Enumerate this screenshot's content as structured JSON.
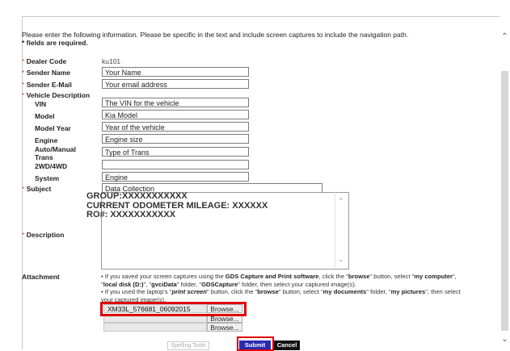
{
  "intro": "Please enter the following information. Please be specific in the text and include screen captures to include the navigation path.",
  "required_note": "* fields are required.",
  "fields": {
    "dealer_code": {
      "label": "Dealer Code",
      "value": "ku101"
    },
    "sender_name": {
      "label": "Sender Name",
      "value": "Your Name"
    },
    "sender_email": {
      "label": "Sender E-Mail",
      "value": "Your email address"
    },
    "vehicle_description": {
      "label": "Vehicle Description"
    },
    "vin": {
      "label": "VIN",
      "value": "The VIN for the vehicle"
    },
    "model": {
      "label": "Model",
      "value": "Kia Model"
    },
    "model_year": {
      "label": "Model Year",
      "value": "Year of the vehicle"
    },
    "engine": {
      "label": "Engine",
      "value": "Engine size"
    },
    "trans": {
      "label": "Auto/Manual Trans",
      "value": "Type of Trans"
    },
    "drive": {
      "label": "2WD/4WD",
      "value": ""
    },
    "system": {
      "label": "System",
      "value": "Engine"
    },
    "subject": {
      "label": "Subject",
      "value": "Data Collection"
    },
    "description": {
      "label": "Description",
      "value": "GROUP:XXXXXXXXXXX\nCURRENT ODOMETER MILEAGE: XXXXXX\nRO#: XXXXXXXXXXX"
    }
  },
  "attachment": {
    "label": "Attachment",
    "line1_pre": "If you saved your screen captures using the ",
    "line1_bold": "GDS Capture and Print software",
    "line1_mid": ", click the \"",
    "line1_browse": "browse",
    "line1_mid2": "\" button, select \"",
    "line1_mycomp": "my computer",
    "line1_end": "\",",
    "line2_pre": "\"",
    "line2_disk": "local disk (D:)",
    "line2_mid": "\", \"",
    "line2_gvci": "gvciData",
    "line2_mid2": "\" folder, \"",
    "line2_gds": "GDSCapture",
    "line2_end": "\" folder, then select your captured image(s).",
    "line3_pre": "If you used the laptop's \"",
    "line3_ps": "print screen",
    "line3_mid": "\" button, click the \"",
    "line3_browse": "browse",
    "line3_mid2": "\" button, select \"",
    "line3_docs": "my documents",
    "line3_mid3": "\" folder, \"",
    "line3_pics": "my pictures",
    "line3_end": "\", then select",
    "line4": "your captured image(s).",
    "files": [
      "XM33L_576681_06092015",
      "",
      ""
    ],
    "browse_label": "Browse..."
  },
  "buttons": {
    "spell": "Spelling Tools",
    "submit": "Submit",
    "cancel": "Cancel"
  },
  "colors": {
    "required": "#d05050",
    "highlight": "#e00000",
    "submit_bg": "#2a2ab0"
  }
}
